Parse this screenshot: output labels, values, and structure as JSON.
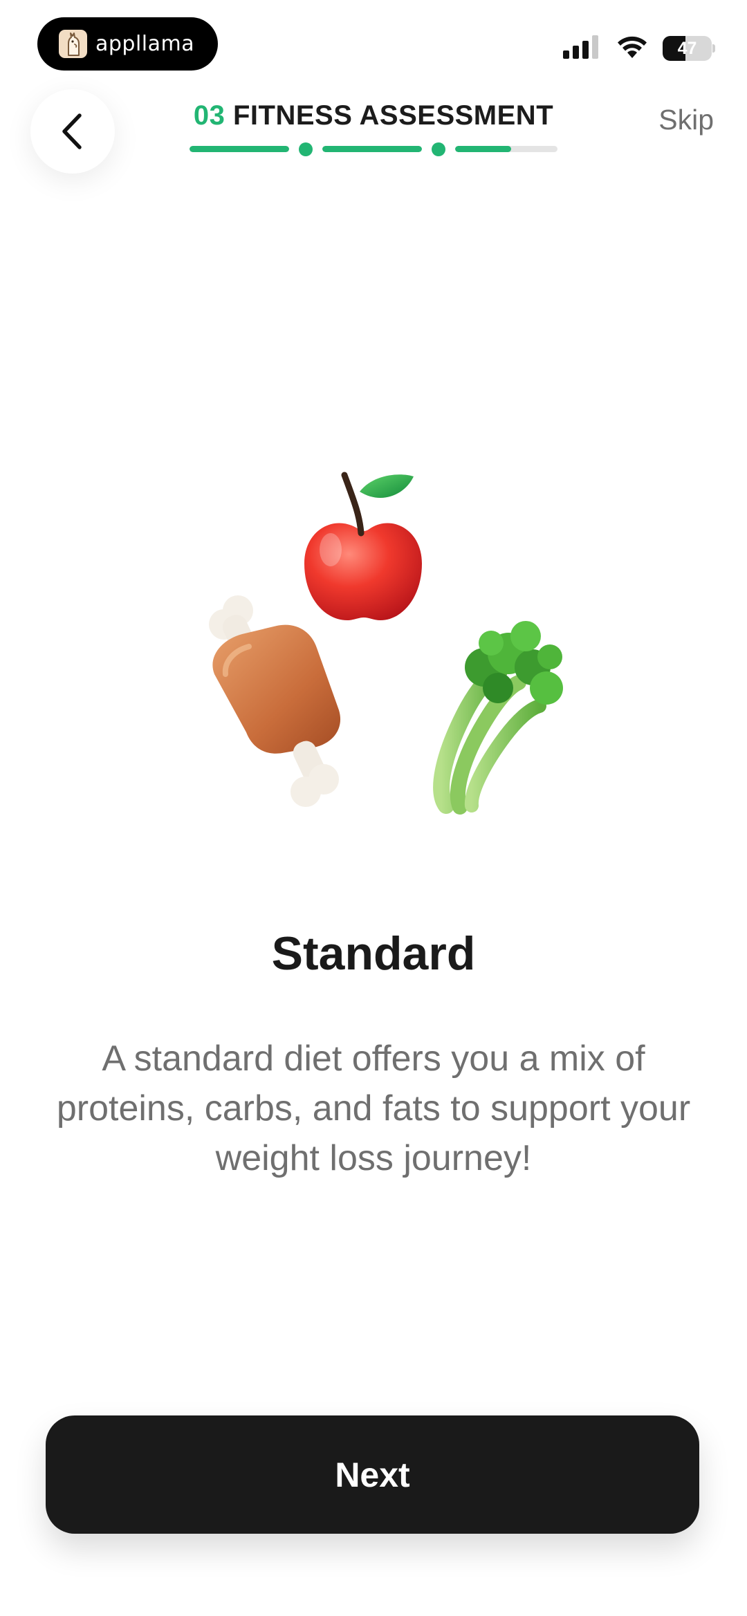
{
  "status_bar": {
    "app_pill_label": "appllama",
    "battery_percent": 47,
    "battery_label": "47"
  },
  "header": {
    "step_number": "03",
    "section_name": "FITNESS ASSESSMENT",
    "skip_label": "Skip",
    "back_icon": "chevron-left-icon",
    "progress_segments": [
      1,
      1,
      0.55
    ]
  },
  "content": {
    "illustration_icons": [
      "apple-icon",
      "meat-drumstick-icon",
      "celery-icon"
    ],
    "diet_title": "Standard",
    "diet_description": "A standard diet offers you a mix of proteins, carbs, and fats to support your weight loss journey!"
  },
  "footer": {
    "next_label": "Next"
  },
  "colors": {
    "accent": "#22b573",
    "primary_button": "#1a1a1a",
    "muted_text": "#6f6f6f"
  }
}
